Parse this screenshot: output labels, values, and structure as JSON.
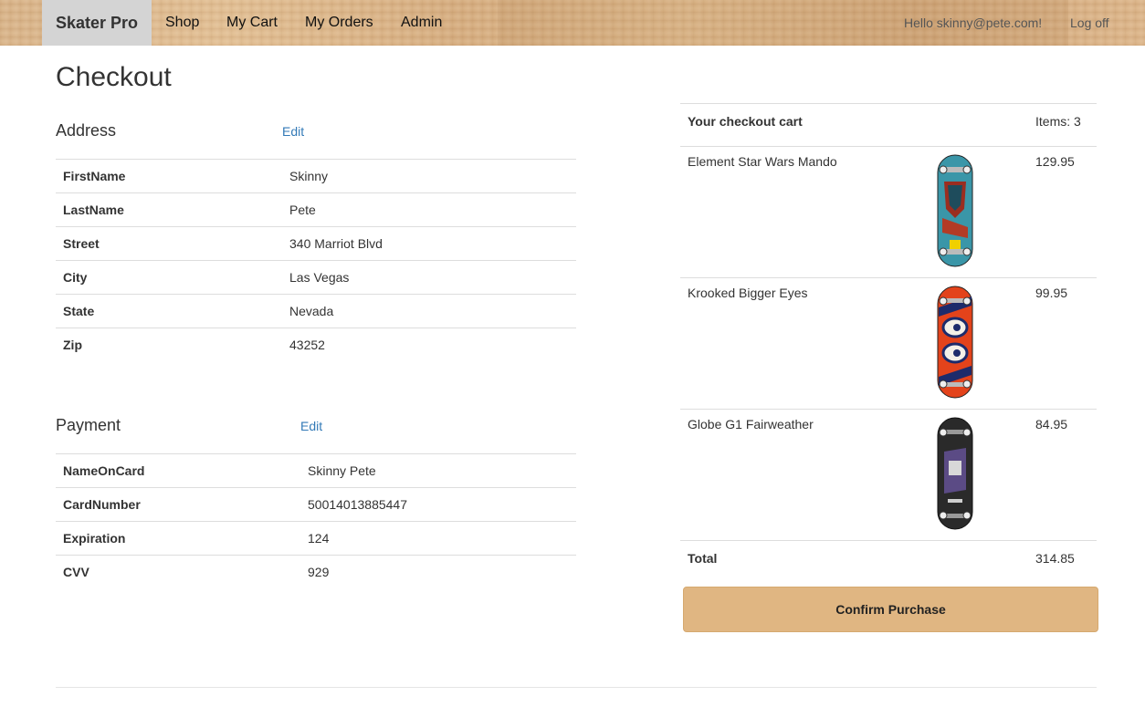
{
  "nav": {
    "brand": "Skater Pro",
    "links": [
      "Shop",
      "My Cart",
      "My Orders",
      "Admin"
    ],
    "greeting": "Hello skinny@pete.com!",
    "logoff": "Log off"
  },
  "page_title": "Checkout",
  "address": {
    "title": "Address",
    "edit": "Edit",
    "rows": [
      {
        "label": "FirstName",
        "value": "Skinny"
      },
      {
        "label": "LastName",
        "value": "Pete"
      },
      {
        "label": "Street",
        "value": "340 Marriot Blvd"
      },
      {
        "label": "City",
        "value": "Las Vegas"
      },
      {
        "label": "State",
        "value": "Nevada"
      },
      {
        "label": "Zip",
        "value": "43252"
      }
    ]
  },
  "payment": {
    "title": "Payment",
    "edit": "Edit",
    "rows": [
      {
        "label": "NameOnCard",
        "value": "Skinny Pete"
      },
      {
        "label": "CardNumber",
        "value": "50014013885447"
      },
      {
        "label": "Expiration",
        "value": "124"
      },
      {
        "label": "CVV",
        "value": "929"
      }
    ]
  },
  "cart": {
    "title": "Your checkout cart",
    "items_count": "Items: 3",
    "items": [
      {
        "name": "Element Star Wars Mando",
        "price": "129.95"
      },
      {
        "name": "Krooked Bigger Eyes",
        "price": "99.95"
      },
      {
        "name": "Globe G1 Fairweather",
        "price": "84.95"
      }
    ],
    "total_label": "Total",
    "total": "314.85"
  },
  "confirm_label": "Confirm Purchase",
  "colors": {
    "brand_bg": "#d4d4d4",
    "link": "#337ab7",
    "confirm_bg": "#e0b682"
  }
}
